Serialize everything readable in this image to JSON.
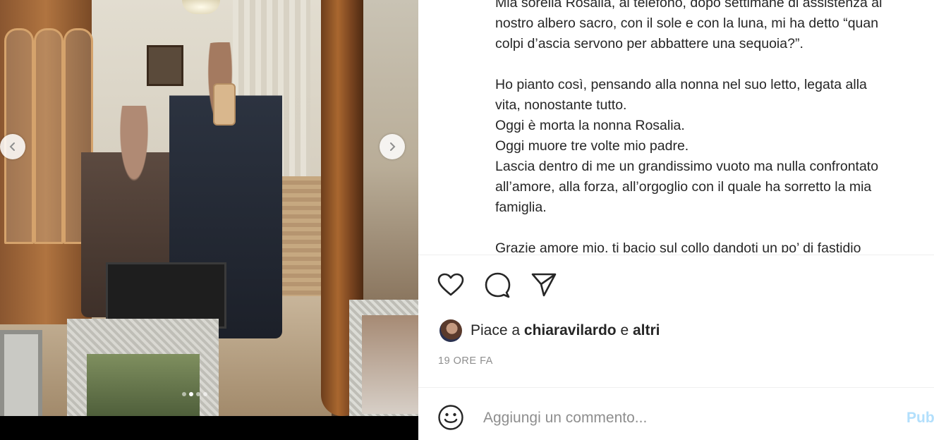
{
  "post": {
    "caption_lines": [
      "Mia sorella Rosalia, al telefono, dopo settimane di assistenza al",
      "nostro albero sacro, con il sole e con la luna, mi ha detto “quan",
      "colpi d’ascia servono per abbattere una sequoia?”.",
      "",
      "Ho pianto così, pensando alla nonna nel suo letto, legata alla",
      "vita, nonostante tutto.",
      "Oggi è morta la nonna Rosalia.",
      "Oggi muore tre volte mio padre.",
      "Lascia dentro di me un grandissimo vuoto ma nulla confrontato",
      "all’amore, alla forza, all’orgoglio con il quale ha sorretto la mia",
      "famiglia.",
      "",
      "Grazie amore mio, ti bacio sul collo dandoti un po’ di fastidio"
    ],
    "likes": {
      "prefix": "Piace a",
      "user": "chiaravilardo",
      "conjunction": "e",
      "others": "altri"
    },
    "timestamp": "19 ORE FA"
  },
  "carousel": {
    "total_slides": 4,
    "active_slide": 2
  },
  "comment": {
    "placeholder": "Aggiungi un commento...",
    "publish_label": "Pubblica"
  },
  "icons": {
    "like": "heart-icon",
    "comment": "comment-icon",
    "share": "send-icon",
    "emoji": "emoji-icon",
    "prev": "chevron-left-icon",
    "next": "chevron-right-icon"
  },
  "colors": {
    "text": "#262626",
    "secondary": "#8e8e8e",
    "publish_disabled": "#b2dffc",
    "divider": "#efefef"
  }
}
